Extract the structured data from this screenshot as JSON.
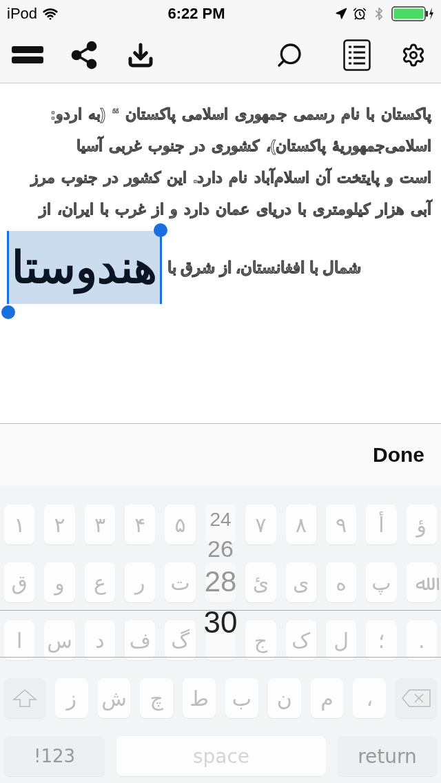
{
  "status_bar": {
    "carrier": "iPod",
    "time": "6:22 PM"
  },
  "editor": {
    "lines": [
      "پاکستان با نام رسمی جمهوری اسلامی پاکستان “ (به اردو:",
      "اسلامی‌جمهوریهٔ پاکستان)، کشوری در جنوب غربی آسیا",
      "است و پایتخت آن اسلام‌آباد نام دارد. این کشور در جنوب مرز",
      "آبی هزار کیلومتری با دریای عمان دارد و از غرب با ایران، از"
    ],
    "last_line": "شمال با افغانستان، از شرق با",
    "selection": "هندوستا"
  },
  "accessory_bar": {
    "done": "Done"
  },
  "keyboard": {
    "rows": [
      {
        "keys": [
          {
            "kind": "char",
            "label": "ؤ"
          },
          {
            "kind": "char",
            "label": "أ"
          },
          {
            "kind": "char",
            "label": "۹"
          },
          {
            "kind": "char",
            "label": "۸"
          },
          {
            "kind": "char",
            "label": "۷"
          },
          {
            "kind": "covered"
          },
          {
            "kind": "char",
            "label": "۵"
          },
          {
            "kind": "char",
            "label": "۴"
          },
          {
            "kind": "char",
            "label": "۳"
          },
          {
            "kind": "char",
            "label": "۲"
          },
          {
            "kind": "char",
            "label": "۱"
          }
        ]
      },
      {
        "keys": [
          {
            "kind": "char",
            "label": "ﷲ"
          },
          {
            "kind": "char",
            "label": "پ"
          },
          {
            "kind": "char",
            "label": "ه"
          },
          {
            "kind": "char",
            "label": "ی"
          },
          {
            "kind": "char",
            "label": "ئ"
          },
          {
            "kind": "covered"
          },
          {
            "kind": "char",
            "label": "ت"
          },
          {
            "kind": "char",
            "label": "ر"
          },
          {
            "kind": "char",
            "label": "ع"
          },
          {
            "kind": "char",
            "label": "و"
          },
          {
            "kind": "char",
            "label": "ق"
          }
        ]
      },
      {
        "keys": [
          {
            "kind": "char",
            "label": "."
          },
          {
            "kind": "char",
            "label": "؛"
          },
          {
            "kind": "char",
            "label": "ل"
          },
          {
            "kind": "char",
            "label": "ک"
          },
          {
            "kind": "char",
            "label": "ج"
          },
          {
            "kind": "covered"
          },
          {
            "kind": "char",
            "label": "گ"
          },
          {
            "kind": "char",
            "label": "ف"
          },
          {
            "kind": "char",
            "label": "د"
          },
          {
            "kind": "char",
            "label": "س"
          },
          {
            "kind": "char",
            "label": "ا"
          }
        ]
      },
      {
        "keys": [
          {
            "kind": "delete"
          },
          {
            "kind": "char",
            "label": "،"
          },
          {
            "kind": "char",
            "label": "م"
          },
          {
            "kind": "char",
            "label": "ن"
          },
          {
            "kind": "char",
            "label": "ب"
          },
          {
            "kind": "char",
            "label": "ط"
          },
          {
            "kind": "char",
            "label": "چ"
          },
          {
            "kind": "char",
            "label": "ش"
          },
          {
            "kind": "char",
            "label": "ز"
          },
          {
            "kind": "shift"
          }
        ]
      },
      {
        "keys": [
          {
            "kind": "return",
            "label": "return"
          },
          {
            "kind": "space",
            "label": "space"
          },
          {
            "kind": "mode",
            "label": "!123"
          }
        ]
      }
    ]
  },
  "size_picker": {
    "items": [
      {
        "label": "24",
        "selected": false
      },
      {
        "label": "26",
        "selected": false
      },
      {
        "label": "28",
        "selected": false
      },
      {
        "label": "30",
        "selected": true
      }
    ]
  }
}
